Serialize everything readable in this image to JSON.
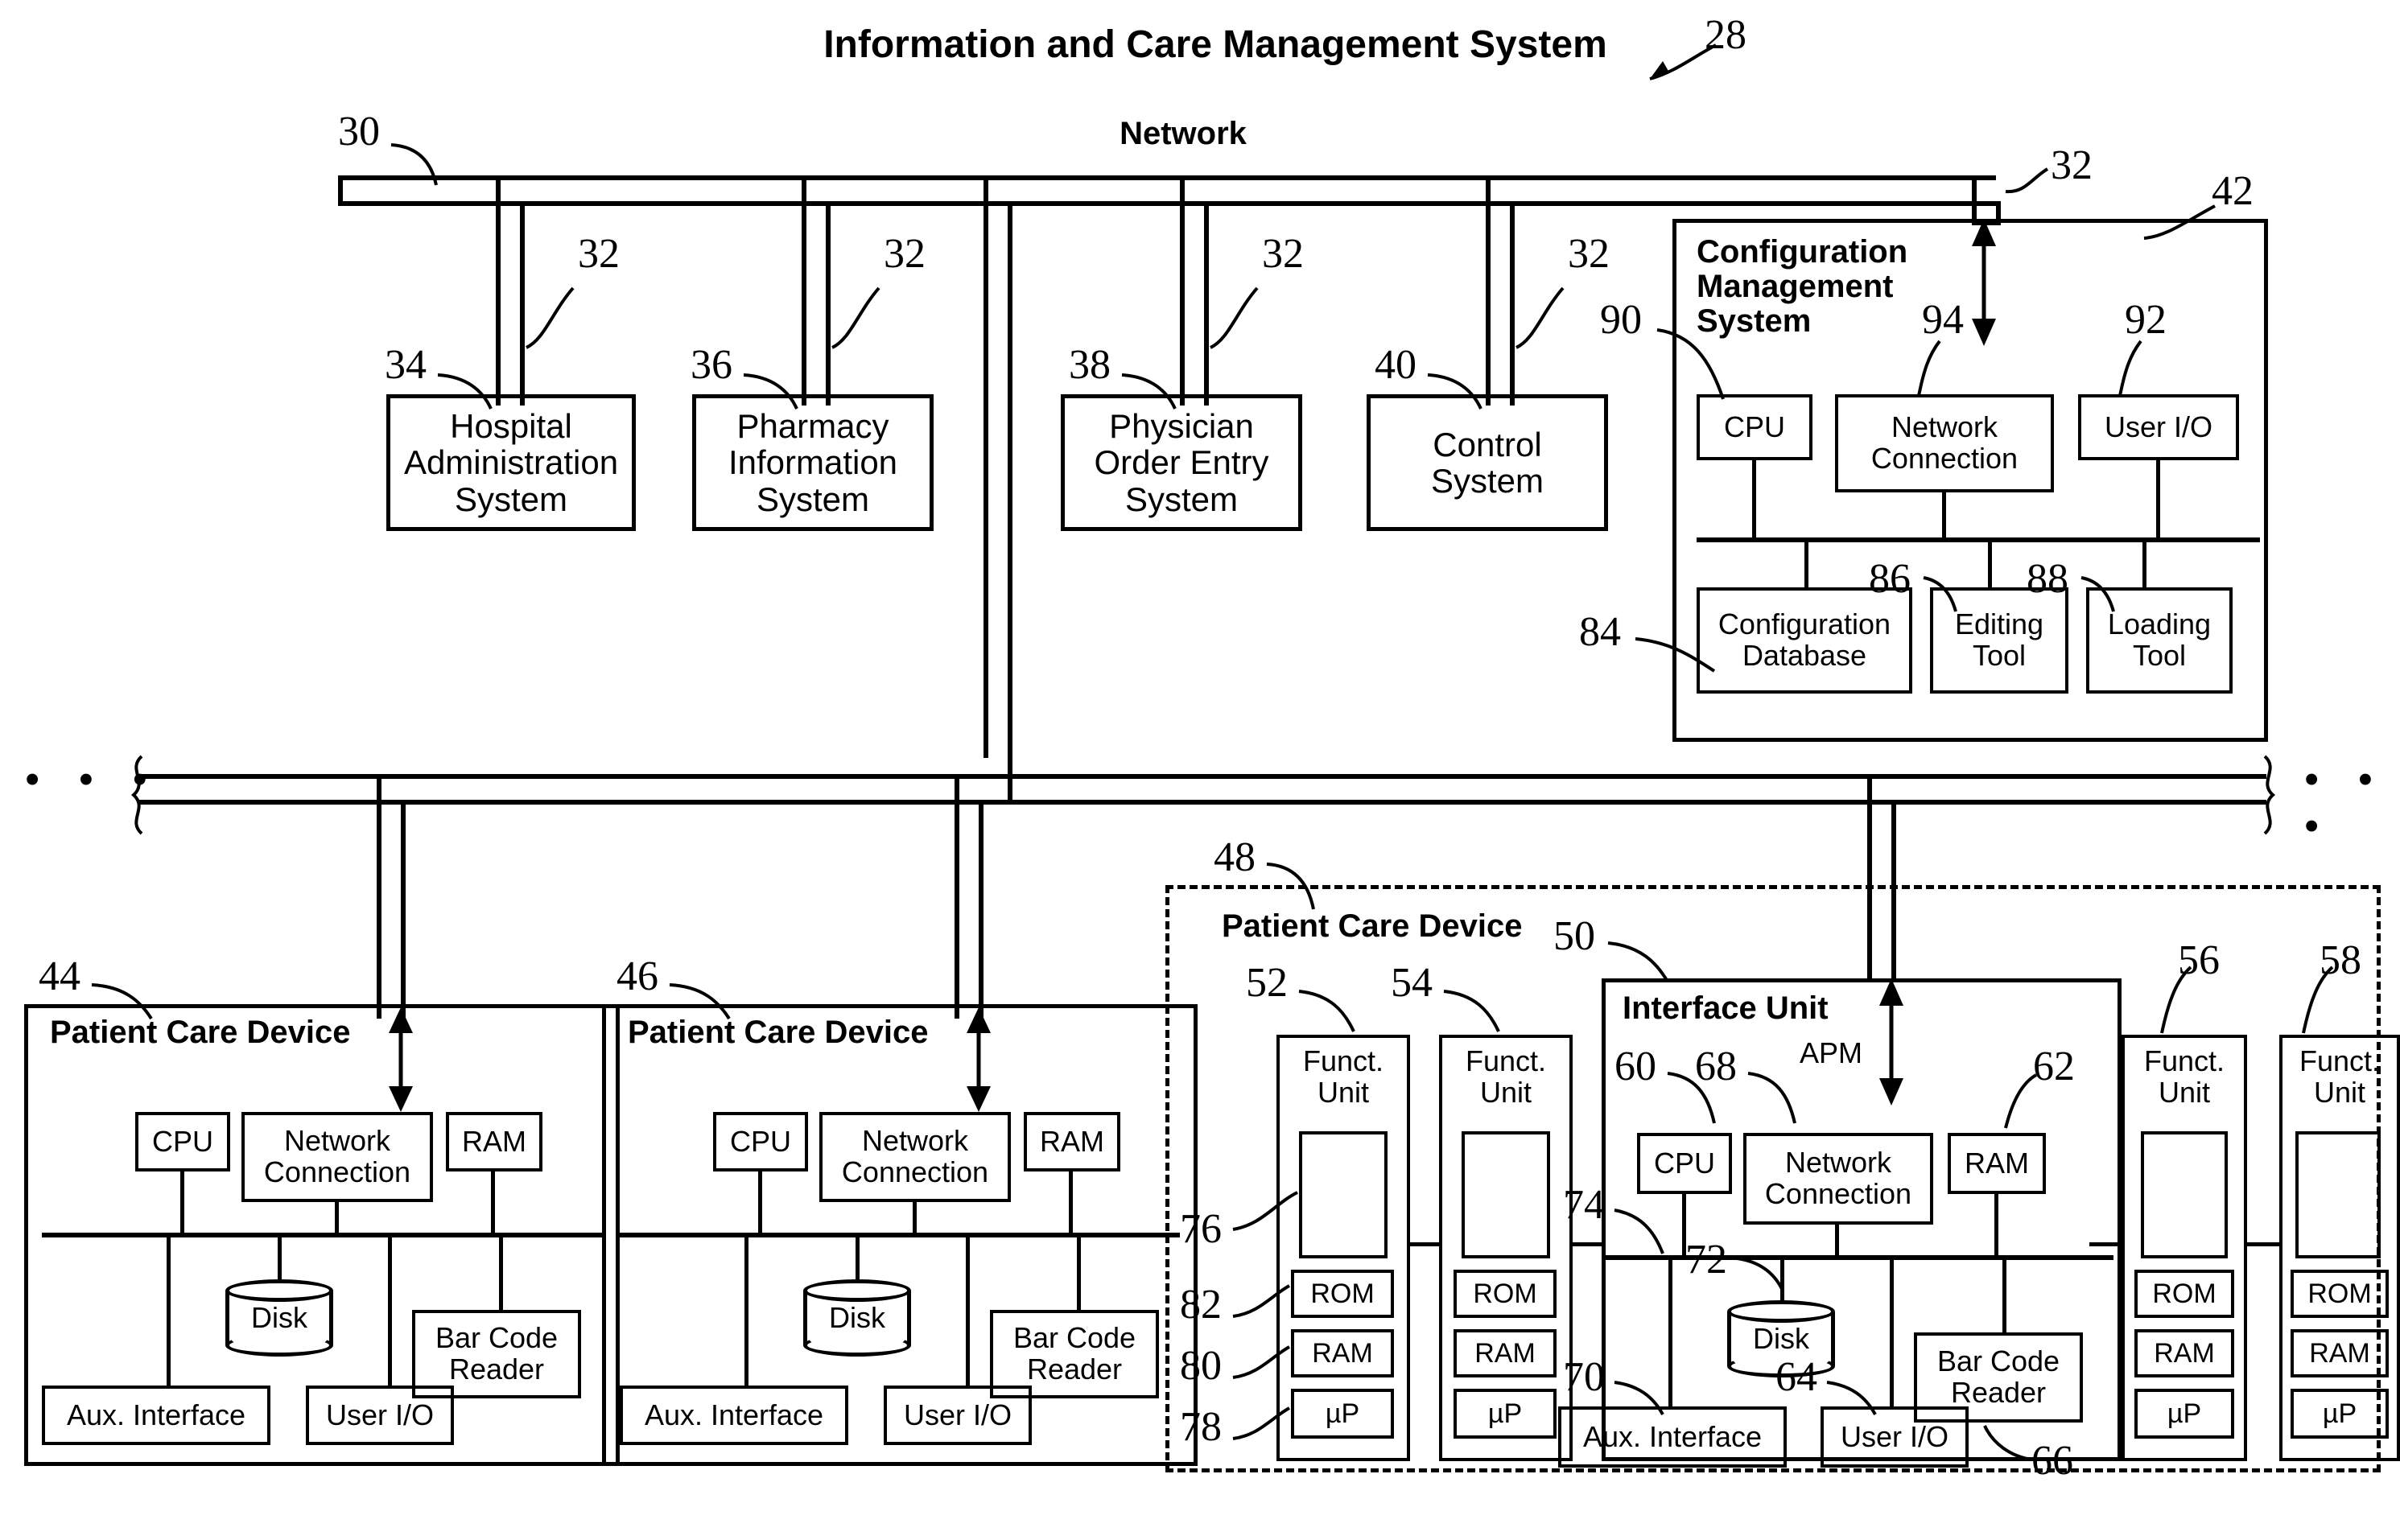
{
  "figure": {
    "title": "Information and Care Management System",
    "title_ref": "28"
  },
  "network": {
    "label": "Network",
    "ref": "30",
    "link_ref": "32",
    "ellipsis": "• • •"
  },
  "top_systems": [
    {
      "ref": "34",
      "label": "Hospital\nAdministration\nSystem"
    },
    {
      "ref": "36",
      "label": "Pharmacy\nInformation\nSystem"
    },
    {
      "ref": "38",
      "label": "Physician\nOrder Entry\nSystem"
    },
    {
      "ref": "40",
      "label": "Control\nSystem"
    }
  ],
  "config_management_system": {
    "ref": "42",
    "title": "Configuration\nManagement\nSystem",
    "cpu": {
      "ref": "90",
      "label": "CPU"
    },
    "network_connection": {
      "ref": "94",
      "label": "Network\nConnection"
    },
    "user_io": {
      "ref": "92",
      "label": "User I/O"
    },
    "configuration_database": {
      "ref": "84",
      "label": "Configuration\nDatabase"
    },
    "editing_tool": {
      "ref": "86",
      "label": "Editing\nTool"
    },
    "loading_tool": {
      "ref": "88",
      "label": "Loading\nTool"
    }
  },
  "patient_care_device_44": {
    "ref": "44",
    "title": "Patient Care Device",
    "cpu": "CPU",
    "network_connection": "Network\nConnection",
    "ram": "RAM",
    "disk": "Disk",
    "bar_code_reader": "Bar Code\nReader",
    "aux_interface": "Aux. Interface",
    "user_io": "User I/O"
  },
  "patient_care_device_46": {
    "ref": "46",
    "title": "Patient Care Device",
    "cpu": "CPU",
    "network_connection": "Network\nConnection",
    "ram": "RAM",
    "disk": "Disk",
    "bar_code_reader": "Bar Code\nReader",
    "aux_interface": "Aux. Interface",
    "user_io": "User I/O"
  },
  "patient_care_device_48": {
    "ref": "48",
    "title": "Patient Care Device",
    "functional_units": [
      {
        "ref": "52",
        "label": "Funct.\nUnit",
        "rom": "ROM",
        "ram": "RAM",
        "up": "µP",
        "panel_ref": "76",
        "rom_ref": "82",
        "ram_ref": "80",
        "up_ref": "78"
      },
      {
        "ref": "54",
        "label": "Funct.\nUnit",
        "rom": "ROM",
        "ram": "RAM",
        "up": "µP"
      },
      {
        "ref": "56",
        "label": "Funct.\nUnit",
        "rom": "ROM",
        "ram": "RAM",
        "up": "µP"
      },
      {
        "ref": "58",
        "label": "Funct.\nUnit",
        "rom": "ROM",
        "ram": "RAM",
        "up": "µP"
      }
    ],
    "interface_unit": {
      "ref": "50",
      "title": "Interface Unit",
      "apm_label": "APM",
      "cpu": {
        "ref": "60",
        "label": "CPU"
      },
      "network_connection": {
        "ref": "68",
        "label": "Network\nConnection"
      },
      "ram": {
        "ref": "62",
        "label": "RAM"
      },
      "bus_ref": "74",
      "disk": {
        "ref": "72",
        "label": "Disk"
      },
      "bar_code_reader": {
        "ref": "66",
        "label": "Bar Code\nReader"
      },
      "aux_interface": {
        "ref": "70",
        "label": "Aux. Interface"
      },
      "user_io": {
        "ref": "64",
        "label": "User I/O"
      }
    }
  }
}
